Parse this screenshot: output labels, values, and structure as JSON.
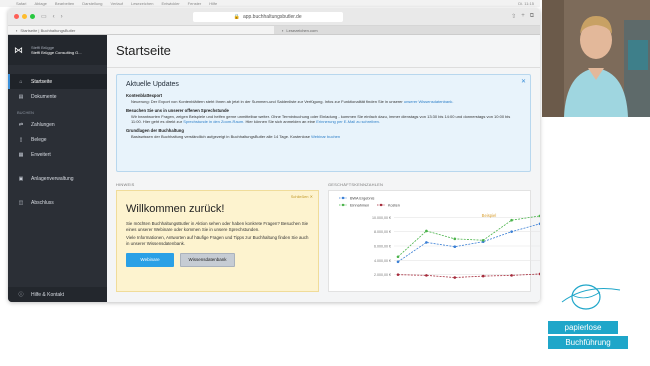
{
  "mac_menu": {
    "items": [
      "Safari",
      "Ablage",
      "Bearbeiten",
      "Darstellung",
      "Verlauf",
      "Lesezeichen",
      "Entwickler",
      "Fenster",
      "Hilfe"
    ],
    "right": "Di. 11:15"
  },
  "browser": {
    "url": "app.buchhaltungsbutler.de",
    "tabs": [
      "Startseite | BuchhaltungsButler",
      "Lesezeichen.com"
    ]
  },
  "sidebar": {
    "user_name": "Steffi Brügge",
    "user_company": "Steffi Brügge Consulting G...",
    "items": [
      {
        "label": "Startseite",
        "icon": "home-icon"
      },
      {
        "label": "Dokumente",
        "icon": "document-icon"
      }
    ],
    "section_label": "BUCHEN",
    "book_items": [
      {
        "label": "Zahlungen",
        "icon": "payments-icon"
      },
      {
        "label": "Belege",
        "icon": "receipt-icon"
      },
      {
        "label": "Erweitert",
        "icon": "grid-icon"
      }
    ],
    "extra_items": [
      {
        "label": "Anlagenverwaltung",
        "icon": "assets-icon"
      },
      {
        "label": "Abschluss",
        "icon": "closing-icon"
      }
    ],
    "help": "Hilfe & Kontakt"
  },
  "main": {
    "page_title": "Startseite",
    "updates": {
      "title": "Aktuelle Updates",
      "items": [
        {
          "title": "Kontenblattexport",
          "text": "Neuerung: Der Export von Kontenblättern steht Ihnen ab jetzt in der Summen-und Saldenliste zur Verfügung. Infos zur Funktionalität finden Sie in unserer",
          "link": "unserer Wissensdatenbank."
        },
        {
          "title": "Besuchen Sie uns in unserer offenen Sprechstunde",
          "text": "Wir beantworten Fragen, zeigen Beispiele und helfen gerne unmittelbar weiter. Ohne Terminbuchung oder Einladung - kommen Sie einfach dazu, immer dienstags von 13:30 bis 14:00 und donnerstags von 10:00 bis 11:00. Hier geht es direkt zur",
          "link": "Sprechstunde in den Zoom-Raum.",
          "text2": "Hier können Sie sich anmelden an eine",
          "link2": "Erinnerung per E-Mail zu schreiben."
        },
        {
          "title": "Grundlagen der Buchhaltung",
          "text": "Basiswissen der Buchhaltung verständlich aufgezeigt in BuchhaltungsButler alle 14 Tage. Kostenlose",
          "link": "Webinar buchen"
        }
      ]
    },
    "hint_label": "HINWEIS",
    "hint": {
      "dismiss": "Schließen",
      "title": "Willkommen zurück!",
      "p1": "Sie möchten BuchhaltungsButler in Aktion sehen oder haben konkrete Fragen? Besuchen Sie eines unserer Webinare oder kommen Sie in unsere Sprechstunden.",
      "p2": "Viele Informationen, Antworten auf häufige Fragen und Tipps zur Buchhaltung finden Sie auch in unserer Wissensdatenbank.",
      "btn_webinare": "Webinare",
      "btn_wissen": "Wissensdatenbank"
    },
    "chart_label": "GESCHÄFTSKENNZAHLEN"
  },
  "brand": {
    "line1": "papierlose",
    "line2": "Buchführung"
  },
  "chart_data": {
    "type": "line",
    "title": "",
    "annotation": "Beispiel",
    "x": [
      1,
      2,
      3,
      4,
      5,
      6,
      7
    ],
    "ylim": [
      0,
      12000
    ],
    "yticks": [
      2000,
      4000,
      6000,
      8000,
      10000
    ],
    "ytick_labels": [
      "2.000,00 €",
      "4.000,00 €",
      "6.000,00 €",
      "8.000,00 €",
      "10.000,00 €"
    ],
    "series": [
      {
        "name": "BWA Ergebnis",
        "color": "#3a7fd5",
        "values": [
          3800,
          6500,
          5900,
          6600,
          8000,
          9100
        ]
      },
      {
        "name": "Einnahmen",
        "color": "#4ab34a",
        "values": [
          4500,
          8100,
          7000,
          6800,
          9600,
          10200
        ]
      },
      {
        "name": "Kosten",
        "color": "#a52a3a",
        "values": [
          2000,
          1900,
          1600,
          1800,
          1900,
          2100
        ]
      }
    ],
    "legend": "top-left",
    "grid": true
  }
}
